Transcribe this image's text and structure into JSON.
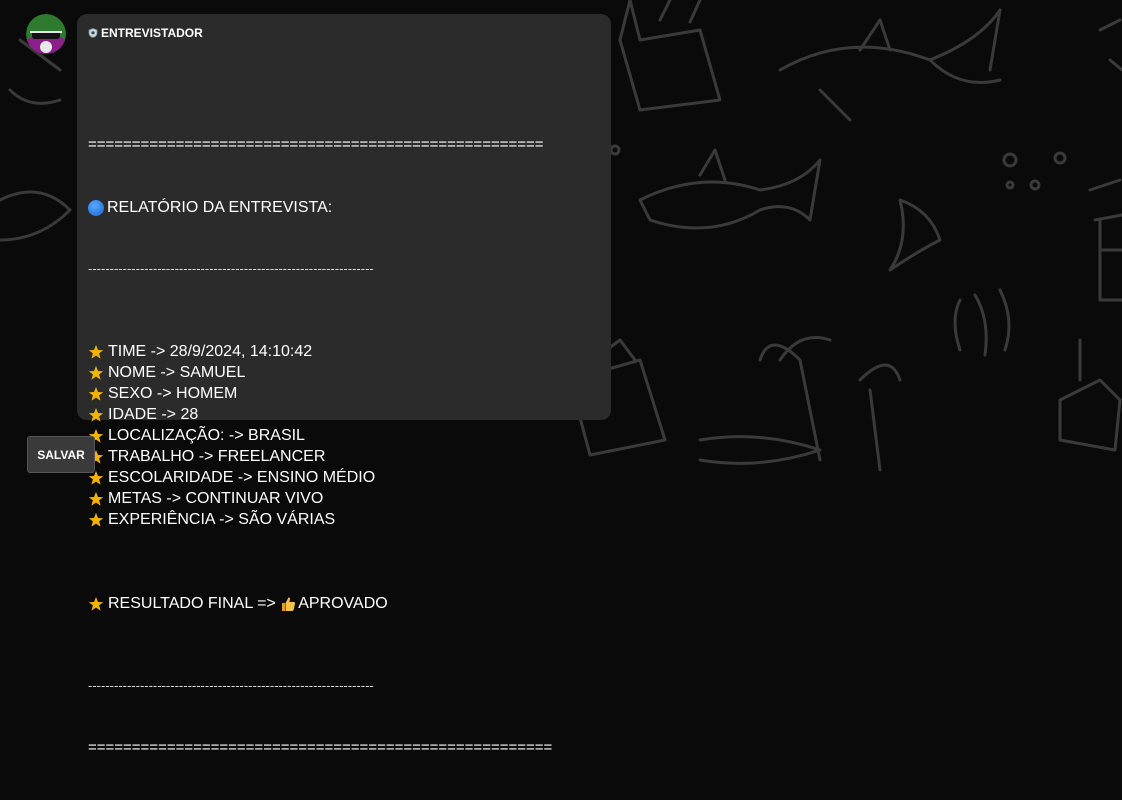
{
  "message": {
    "sender": "ENTREVISTADOR",
    "report": {
      "equals_line_top": "====================================================",
      "title": "RELATÓRIO DA ENTREVISTA:",
      "dash_line_top": "------------------------------------------------------------------",
      "items": [
        {
          "text": "TIME -> 28/9/2024, 14:10:42"
        },
        {
          "text": "NOME -> SAMUEL"
        },
        {
          "text": "SEXO -> HOMEM"
        },
        {
          "text": "IDADE -> 28"
        },
        {
          "text": "LOCALIZAÇÃO: -> BRASIL"
        },
        {
          "text": "TRABALHO -> FREELANCER"
        },
        {
          "text": "ESCOLARIDADE -> ENSINO MÉDIO"
        },
        {
          "text": "METAS -> CONTINUAR VIVO"
        },
        {
          "text": "EXPERIÊNCIA -> SÃO VÁRIAS"
        }
      ],
      "final_label": "RESULTADO FINAL => ",
      "final_value": "APROVADO",
      "dash_line_bottom": "------------------------------------------------------------------",
      "equals_line_bottom": "====================================================="
    }
  },
  "actions": {
    "save_label": "SALVAR"
  },
  "colors": {
    "background": "#0a0a0a",
    "bubble": "#2b2b2b",
    "star": "#f5b301",
    "doodle": "#3a3a3a"
  },
  "icons": {
    "avatar": "avatar-masked-figure",
    "sender_badge": "shield-icon",
    "title_marker": "blue-circle-icon",
    "bullet": "star-icon",
    "result_marker": "thumbs-up-icon"
  }
}
